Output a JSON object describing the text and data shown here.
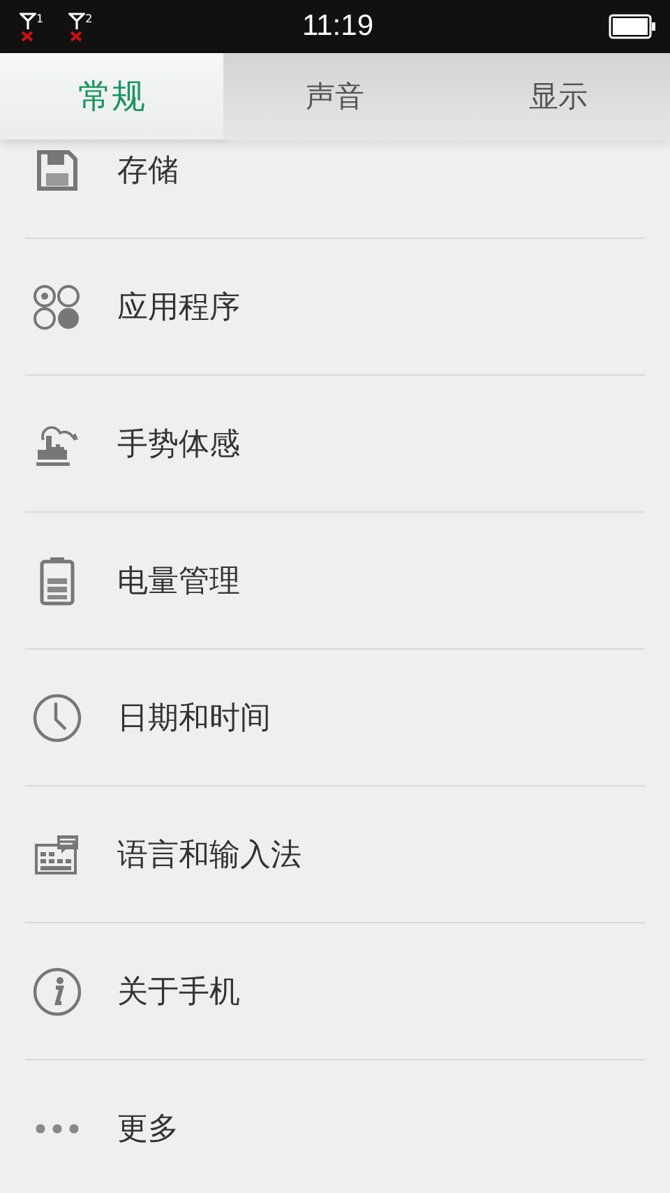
{
  "status_bar": {
    "sims": [
      {
        "label": "1",
        "no_service": true
      },
      {
        "label": "2",
        "no_service": true
      }
    ],
    "time": "11:19"
  },
  "tabs": [
    {
      "label": "常规",
      "selected": true
    },
    {
      "label": "声音",
      "selected": false
    },
    {
      "label": "显示",
      "selected": false
    }
  ],
  "items": [
    {
      "label": "存储",
      "kind": "storage"
    },
    {
      "label": "应用程序",
      "kind": "apps"
    },
    {
      "label": "手势体感",
      "kind": "gesture"
    },
    {
      "label": "电量管理",
      "kind": "battery"
    },
    {
      "label": "日期和时间",
      "kind": "clock"
    },
    {
      "label": "语言和输入法",
      "kind": "keyboard"
    },
    {
      "label": "关于手机",
      "kind": "info"
    },
    {
      "label": "更多",
      "kind": "more"
    }
  ]
}
